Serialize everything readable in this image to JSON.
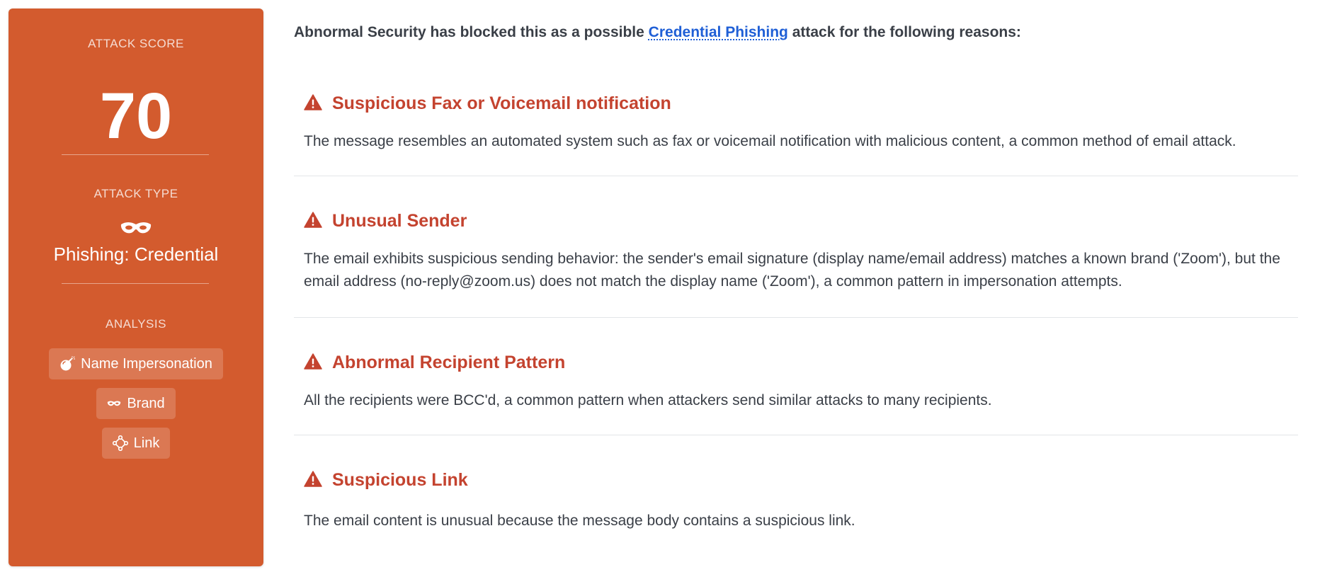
{
  "score_panel": {
    "score_label": "ATTACK SCORE",
    "score_value": "70",
    "type_label": "ATTACK TYPE",
    "type_icon": "mask-icon",
    "type_value": "Phishing: Credential",
    "analysis_label": "ANALYSIS",
    "tags": [
      {
        "icon": "bomb-icon",
        "label": "Name Impersonation"
      },
      {
        "icon": "mask-icon",
        "label": "Brand"
      },
      {
        "icon": "link-nodes-icon",
        "label": "Link"
      }
    ],
    "panel_color": "#d35b2e"
  },
  "content": {
    "intro_before": "Abnormal Security has blocked this as a possible ",
    "intro_link": "Credential Phishing",
    "intro_after": " attack for the following reasons:",
    "reasons": [
      {
        "icon": "warning-triangle-icon",
        "title": "Suspicious Fax or Voicemail notification",
        "description": "The message resembles an automated system such as fax or voicemail notification with malicious content, a common method of email attack."
      },
      {
        "icon": "warning-triangle-icon",
        "title": "Unusual Sender",
        "description": "The email exhibits suspicious sending behavior: the sender's email signature (display name/email address) matches a known brand ('Zoom'), but the email address (no-reply@zoom.us) does not match the display name ('Zoom'), a common pattern in impersonation attempts."
      },
      {
        "icon": "warning-triangle-icon",
        "title": "Abnormal Recipient Pattern",
        "description": "All the recipients were BCC'd, a common pattern when attackers send similar attacks to many recipients."
      },
      {
        "icon": "warning-triangle-icon",
        "title": "Suspicious Link",
        "description": "The email content is unusual because the message body contains a suspicious link."
      }
    ],
    "accent_color": "#c4432f",
    "link_color": "#1f5fd6"
  }
}
